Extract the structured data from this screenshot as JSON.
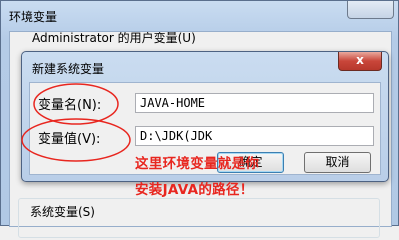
{
  "outer_window": {
    "title": "环境变量",
    "user_vars_label": "Administrator 的用户变量(U)",
    "system_vars_label": "系统变量(S)"
  },
  "dialog": {
    "title": "新建系统变量",
    "close_label": "x",
    "name_label": "变量名(N):",
    "name_value": "JAVA-HOME",
    "value_label": "变量值(V):",
    "value_value": "D:\\JDK(JDK",
    "ok_label": "确定",
    "cancel_label": "取消"
  },
  "annotation": {
    "line1": "这里环境变量就是你",
    "line2": "安装JAVA的路径！",
    "color": "#e8261f"
  }
}
